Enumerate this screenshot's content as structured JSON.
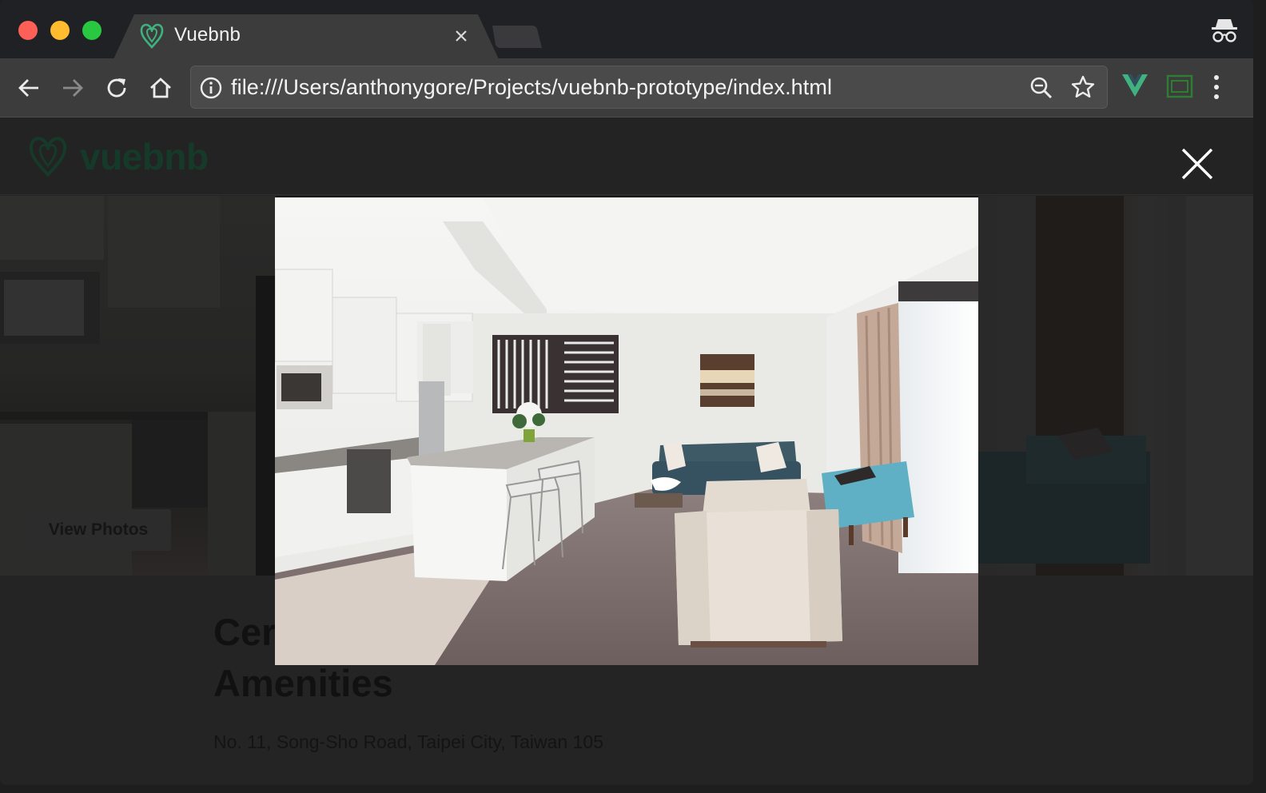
{
  "browser": {
    "tab": {
      "title": "Vuebnb"
    },
    "address_bar": {
      "url": "file:///Users/anthonygore/Projects/vuebnb-prototype/index.html"
    },
    "icons": [
      "back-icon",
      "forward-icon",
      "reload-icon",
      "home-icon",
      "info-icon",
      "zoom-icon",
      "star-icon",
      "vue-devtools-icon",
      "cast-icon",
      "menu-icon",
      "incognito-icon"
    ]
  },
  "site": {
    "logo_text": "vuebnb",
    "view_photos_label": "View Photos",
    "listing_title_line1": "Cer",
    "listing_title_line2": "Amenities",
    "address": "No. 11, Song-Sho Road, Taipei City, Taiwan 105"
  },
  "colors": {
    "brand_green": "#3fb27f",
    "chrome_dark": "#202124",
    "toolbar": "#3c3c3d"
  }
}
